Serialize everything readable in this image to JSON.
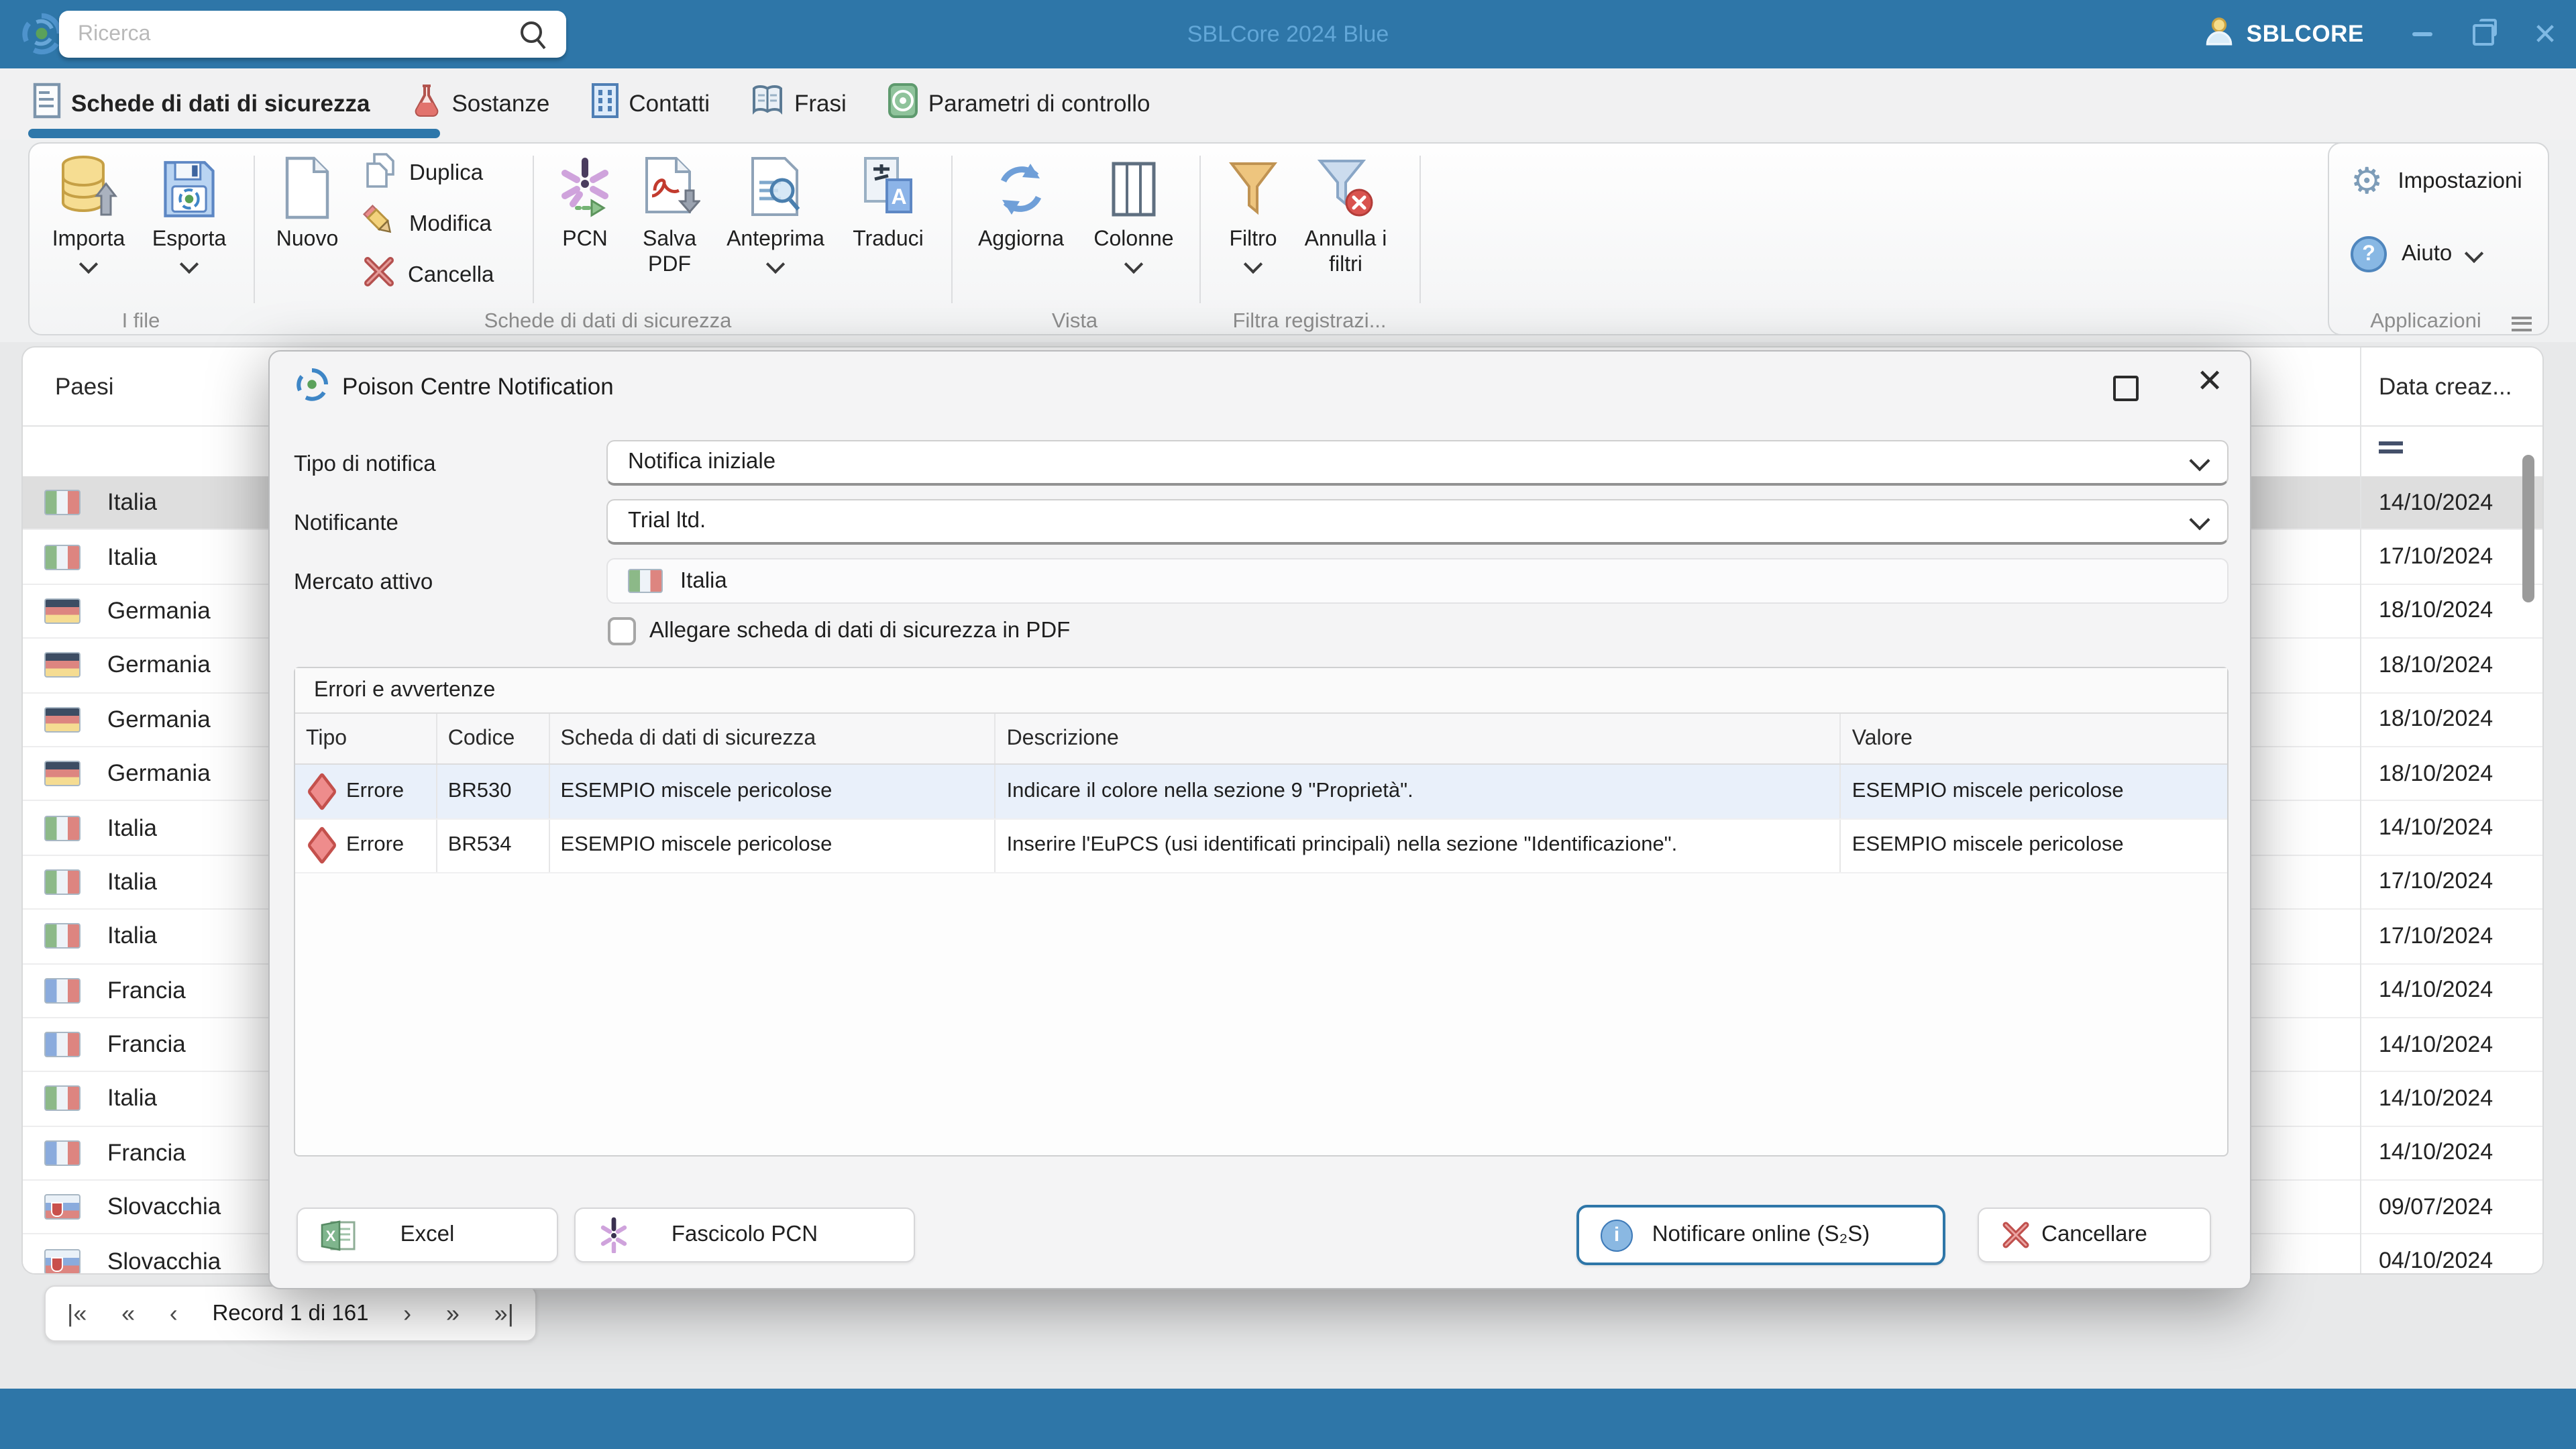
{
  "titlebar": {
    "search_placeholder": "Ricerca",
    "app_title": "SBLCore 2024 Blue",
    "user_label": "SBLCORE"
  },
  "tabs": [
    {
      "label": "Schede di dati di sicurezza"
    },
    {
      "label": "Sostanze"
    },
    {
      "label": "Contatti"
    },
    {
      "label": "Frasi"
    },
    {
      "label": "Parametri di controllo"
    }
  ],
  "ribbon": {
    "importa": "Importa",
    "esporta": "Esporta",
    "nuovo": "Nuovo",
    "duplica": "Duplica",
    "modifica": "Modifica",
    "cancella": "Cancella",
    "pcn": "PCN",
    "salva_pdf": "Salva PDF",
    "anteprima": "Anteprima",
    "traduci": "Traduci",
    "aggiorna": "Aggiorna",
    "colonne": "Colonne",
    "filtro": "Filtro",
    "annulla_filtri": "Annulla i filtri",
    "impostazioni": "Impostazioni",
    "aiuto": "Aiuto",
    "groups": {
      "file": "I file",
      "sds": "Schede di dati di sicurezza",
      "vista": "Vista",
      "filtra": "Filtra registrazi...",
      "applicazioni": "Applicazioni"
    }
  },
  "table": {
    "col_paesi": "Paesi",
    "col_data": "Data creaz...",
    "rows": [
      {
        "country": "Italia",
        "date": "14/10/2024",
        "selected": true
      },
      {
        "country": "Italia",
        "date": "17/10/2024",
        "selected": false
      },
      {
        "country": "Germania",
        "date": "18/10/2024",
        "selected": false
      },
      {
        "country": "Germania",
        "date": "18/10/2024",
        "selected": false
      },
      {
        "country": "Germania",
        "date": "18/10/2024",
        "selected": false
      },
      {
        "country": "Germania",
        "date": "18/10/2024",
        "selected": false
      },
      {
        "country": "Italia",
        "date": "14/10/2024",
        "selected": false
      },
      {
        "country": "Italia",
        "date": "17/10/2024",
        "selected": false
      },
      {
        "country": "Italia",
        "date": "17/10/2024",
        "selected": false
      },
      {
        "country": "Francia",
        "date": "14/10/2024",
        "selected": false
      },
      {
        "country": "Francia",
        "date": "14/10/2024",
        "selected": false
      },
      {
        "country": "Italia",
        "date": "14/10/2024",
        "selected": false
      },
      {
        "country": "Francia",
        "date": "14/10/2024",
        "selected": false
      },
      {
        "country": "Slovacchia",
        "date": "09/07/2024",
        "selected": false
      },
      {
        "country": "Slovacchia",
        "date": "04/10/2024",
        "selected": false
      }
    ]
  },
  "dialog": {
    "title": "Poison Centre Notification",
    "tipo_label": "Tipo di notifica",
    "tipo_value": "Notifica iniziale",
    "notificante_label": "Notificante",
    "notificante_value": "Trial ltd.",
    "mercato_label": "Mercato attivo",
    "mercato_value": "Italia",
    "checkbox_label": "Allegare scheda di dati di sicurezza in PDF",
    "errors_title": "Errori e avvertenze",
    "errors_columns": [
      "Tipo",
      "Codice",
      "Scheda di dati di sicurezza",
      "Descrizione",
      "Valore"
    ],
    "errors_rows": [
      {
        "tipo": "Errore",
        "codice": "BR530",
        "scheda": "ESEMPIO miscele pericolose",
        "descrizione": "Indicare il colore nella sezione 9 \"Proprietà\".",
        "valore": "ESEMPIO miscele pericolose",
        "highlighted": true
      },
      {
        "tipo": "Errore",
        "codice": "BR534",
        "scheda": "ESEMPIO miscele pericolose",
        "descrizione": "Inserire l'EuPCS (usi identificati principali) nella sezione \"Identificazione\".",
        "valore": "ESEMPIO miscele pericolose",
        "highlighted": false
      }
    ],
    "btn_excel": "Excel",
    "btn_fascicolo": "Fascicolo PCN",
    "btn_notificare": "Notificare online (S₂S)",
    "btn_cancellare": "Cancellare"
  },
  "record_nav": {
    "label": "Record 1 di 161",
    "first": "|«",
    "prev_page": "«",
    "prev": "‹",
    "next": "›",
    "next_page": "»",
    "last": "»|"
  }
}
